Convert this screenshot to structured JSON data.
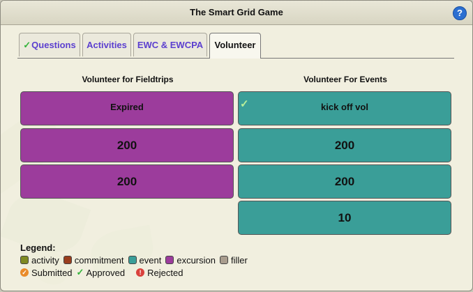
{
  "window": {
    "title": "The Smart Grid Game",
    "help_glyph": "?"
  },
  "tabs": [
    {
      "label": "Questions",
      "completed": true
    },
    {
      "label": "Activities"
    },
    {
      "label": "EWC & EWCPA"
    },
    {
      "label": "Volunteer",
      "active": true
    }
  ],
  "columns": [
    {
      "heading": "Volunteer for Fieldtrips",
      "type": "excursion",
      "cells": [
        {
          "text": "Expired"
        },
        {
          "text": "200"
        },
        {
          "text": "200"
        }
      ]
    },
    {
      "heading": "Volunteer For Events",
      "type": "event",
      "cells": [
        {
          "text": "kick off vol",
          "approved": true
        },
        {
          "text": "200"
        },
        {
          "text": "200"
        },
        {
          "text": "10"
        }
      ]
    }
  ],
  "legend": {
    "title": "Legend:",
    "types": [
      {
        "label": "activity",
        "color": "#7f8a22"
      },
      {
        "label": "commitment",
        "color": "#9a3d1d"
      },
      {
        "label": "event",
        "color": "#3a9e98"
      },
      {
        "label": "excursion",
        "color": "#9c3c9c"
      },
      {
        "label": "filler",
        "color": "#a99d8e"
      }
    ],
    "statuses": [
      {
        "label": "Submitted",
        "glyph": "✓"
      },
      {
        "label": "Approved",
        "glyph": "✓"
      },
      {
        "label": "Rejected",
        "glyph": "!"
      }
    ]
  }
}
